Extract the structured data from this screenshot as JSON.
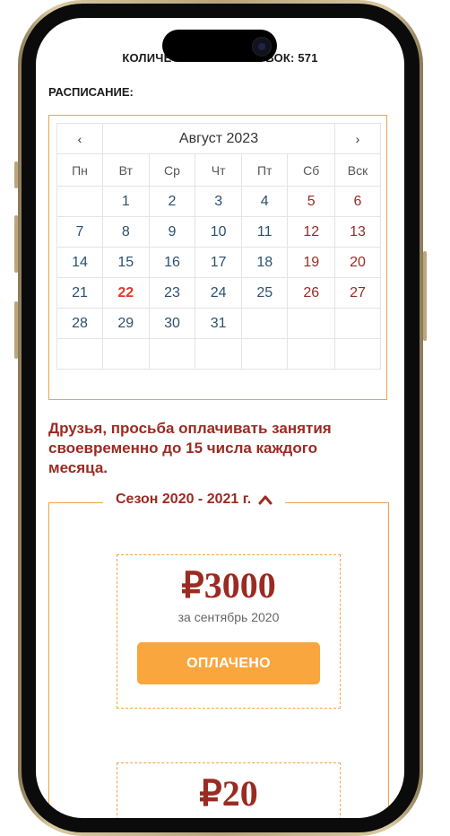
{
  "stats": {
    "workouts_label": "КОЛИЧЕСТВО ТРЕНИРОВОК: 571"
  },
  "schedule": {
    "label": "РАСПИСАНИЕ:"
  },
  "calendar": {
    "prev": "‹",
    "next": "›",
    "month": "Август 2023",
    "weekdays": [
      "Пн",
      "Вт",
      "Ср",
      "Чт",
      "Пт",
      "Сб",
      "Вск"
    ],
    "weeks": [
      [
        "",
        "1",
        "2",
        "3",
        "4",
        "5",
        "6"
      ],
      [
        "7",
        "8",
        "9",
        "10",
        "11",
        "12",
        "13"
      ],
      [
        "14",
        "15",
        "16",
        "17",
        "18",
        "19",
        "20"
      ],
      [
        "21",
        "22",
        "23",
        "24",
        "25",
        "26",
        "27"
      ],
      [
        "28",
        "29",
        "30",
        "31",
        "",
        "",
        ""
      ],
      [
        "",
        "",
        "",
        "",
        "",
        "",
        ""
      ]
    ],
    "today": "22",
    "colors": {
      "weekday": "#2b5170",
      "weekend": "#9b2b22",
      "today": "#e03a2a",
      "border": "#f0a24a"
    }
  },
  "notice": {
    "text": "Друзья, просьба оплачивать занятия своевременно до 15 числа каждого месяца."
  },
  "season": {
    "title": "Сезон 2020 - 2021 г.",
    "toggle_icon": "chevron-up-icon"
  },
  "payments": [
    {
      "price": "₽3000",
      "period": "за сентябрь 2020",
      "status": "ОПЛАЧЕНО"
    },
    {
      "price": "₽20"
    }
  ],
  "colors": {
    "accent": "#f9a63e",
    "brand_red": "#9b2b22"
  }
}
